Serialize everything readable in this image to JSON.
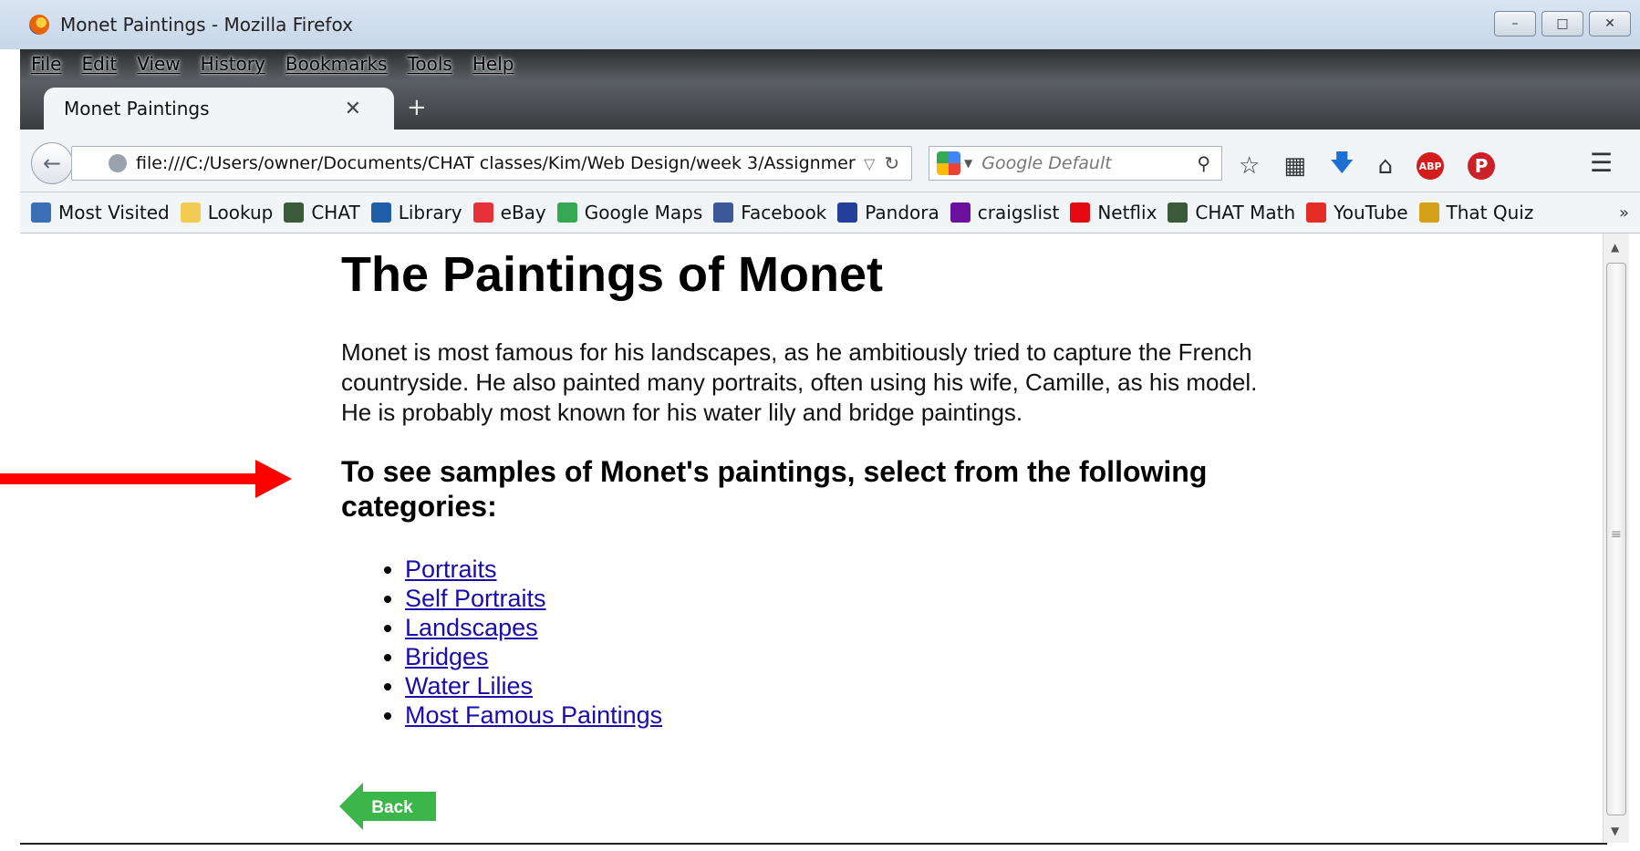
{
  "window": {
    "title": "Monet Paintings - Mozilla Firefox",
    "controls": [
      "–",
      "□",
      "✕"
    ]
  },
  "menu": [
    "File",
    "Edit",
    "View",
    "History",
    "Bookmarks",
    "Tools",
    "Help"
  ],
  "tab": {
    "label": "Monet Paintings",
    "close": "✕",
    "new": "+"
  },
  "nav": {
    "url": "file:///C:/Users/owner/Documents/CHAT classes/Kim/Web Design/week 3/Assignmer",
    "search_placeholder": "Google Default"
  },
  "bookmarks": [
    {
      "label": "Most Visited",
      "color": "#3b6fb3"
    },
    {
      "label": "Lookup",
      "color": "#f2cc52"
    },
    {
      "label": "CHAT",
      "color": "#3a5a3a"
    },
    {
      "label": "Library",
      "color": "#1f5fa8"
    },
    {
      "label": "eBay",
      "color": "#e53238"
    },
    {
      "label": "Google Maps",
      "color": "#34a853"
    },
    {
      "label": "Facebook",
      "color": "#3b5998"
    },
    {
      "label": "Pandora",
      "color": "#224099"
    },
    {
      "label": "craigslist",
      "color": "#6b0f9e"
    },
    {
      "label": "Netflix",
      "color": "#e50914"
    },
    {
      "label": "CHAT Math",
      "color": "#3a5a3a"
    },
    {
      "label": "YouTube",
      "color": "#e52d27"
    },
    {
      "label": "That Quiz",
      "color": "#d4a017"
    }
  ],
  "page": {
    "title": "The Paintings of Monet",
    "intro": "Monet is most famous for his landscapes, as he ambitiously tried to capture the French countryside. He also painted many portraits, often using his wife, Camille, as his model. He is probably most known for his water lily and bridge paintings.",
    "subhead": "To see samples of Monet's paintings, select from the following categories:",
    "links": [
      "Portraits",
      "Self Portraits",
      "Landscapes",
      "Bridges",
      "Water Lilies",
      "Most Famous Paintings"
    ],
    "back_label": "Back"
  },
  "colors": {
    "arrow": "#ff0000",
    "back_button": "#3cb54a",
    "link": "#1a0dab"
  }
}
